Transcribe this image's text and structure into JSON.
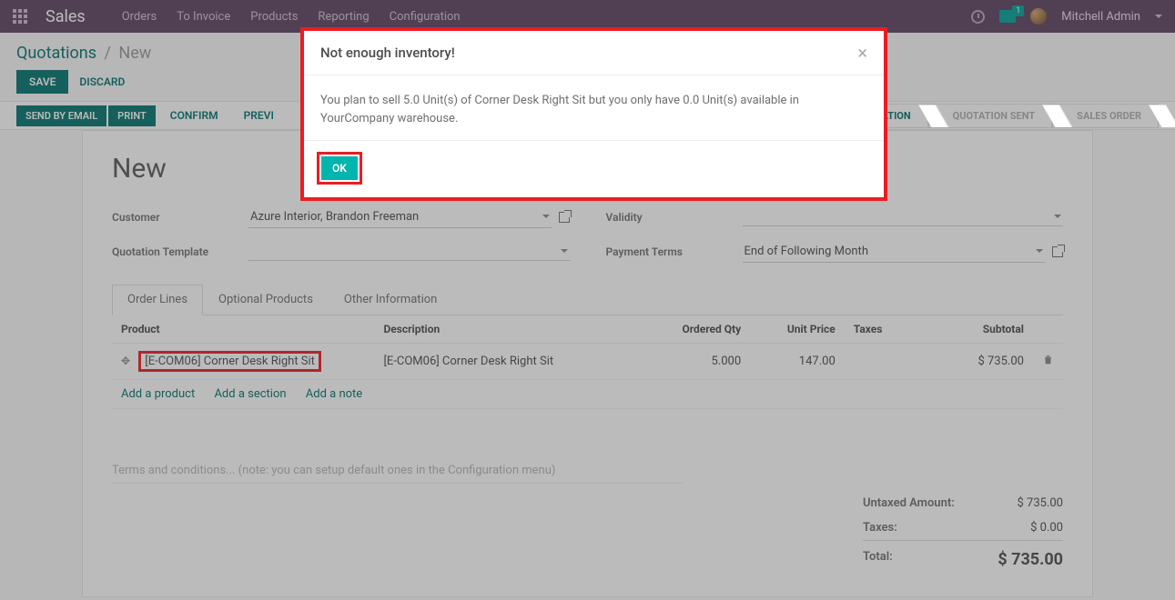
{
  "topnav": {
    "app": "Sales",
    "menu": [
      "Orders",
      "To Invoice",
      "Products",
      "Reporting",
      "Configuration"
    ],
    "chat_badge": "1",
    "user": "Mitchell Admin"
  },
  "breadcrumb": {
    "main": "Quotations",
    "current": "New"
  },
  "buttons": {
    "save": "SAVE",
    "discard": "DISCARD"
  },
  "actionbar": {
    "send": "SEND BY EMAIL",
    "print": "PRINT",
    "confirm": "CONFIRM",
    "preview": "PREVI"
  },
  "status": {
    "quotation": "QUOTATION",
    "sent": "QUOTATION SENT",
    "order": "SALES ORDER"
  },
  "form": {
    "title": "New",
    "customer_label": "Customer",
    "customer_value": "Azure Interior, Brandon Freeman",
    "template_label": "Quotation Template",
    "template_value": "",
    "validity_label": "Validity",
    "validity_value": "",
    "terms_label": "Payment Terms",
    "terms_value": "End of Following Month"
  },
  "tabs": {
    "lines": "Order Lines",
    "optional": "Optional Products",
    "other": "Other Information"
  },
  "table": {
    "headers": {
      "product": "Product",
      "desc": "Description",
      "qty": "Ordered Qty",
      "price": "Unit Price",
      "taxes": "Taxes",
      "subtotal": "Subtotal"
    },
    "row": {
      "product": "[E-COM06] Corner Desk Right Sit",
      "desc": "[E-COM06] Corner Desk Right Sit",
      "qty": "5.000",
      "price": "147.00",
      "taxes": "",
      "subtotal": "$ 735.00"
    },
    "add_product": "Add a product",
    "add_section": "Add a section",
    "add_note": "Add a note",
    "terms_placeholder": "Terms and conditions... (note: you can setup default ones in the Configuration menu)"
  },
  "totals": {
    "untaxed_label": "Untaxed Amount:",
    "untaxed_value": "$ 735.00",
    "taxes_label": "Taxes:",
    "taxes_value": "$ 0.00",
    "total_label": "Total:",
    "total_value": "$ 735.00"
  },
  "modal": {
    "title": "Not enough inventory!",
    "body": "You plan to sell 5.0 Unit(s) of Corner Desk Right Sit but you only have 0.0 Unit(s) available in YourCompany warehouse.",
    "ok": "OK"
  }
}
